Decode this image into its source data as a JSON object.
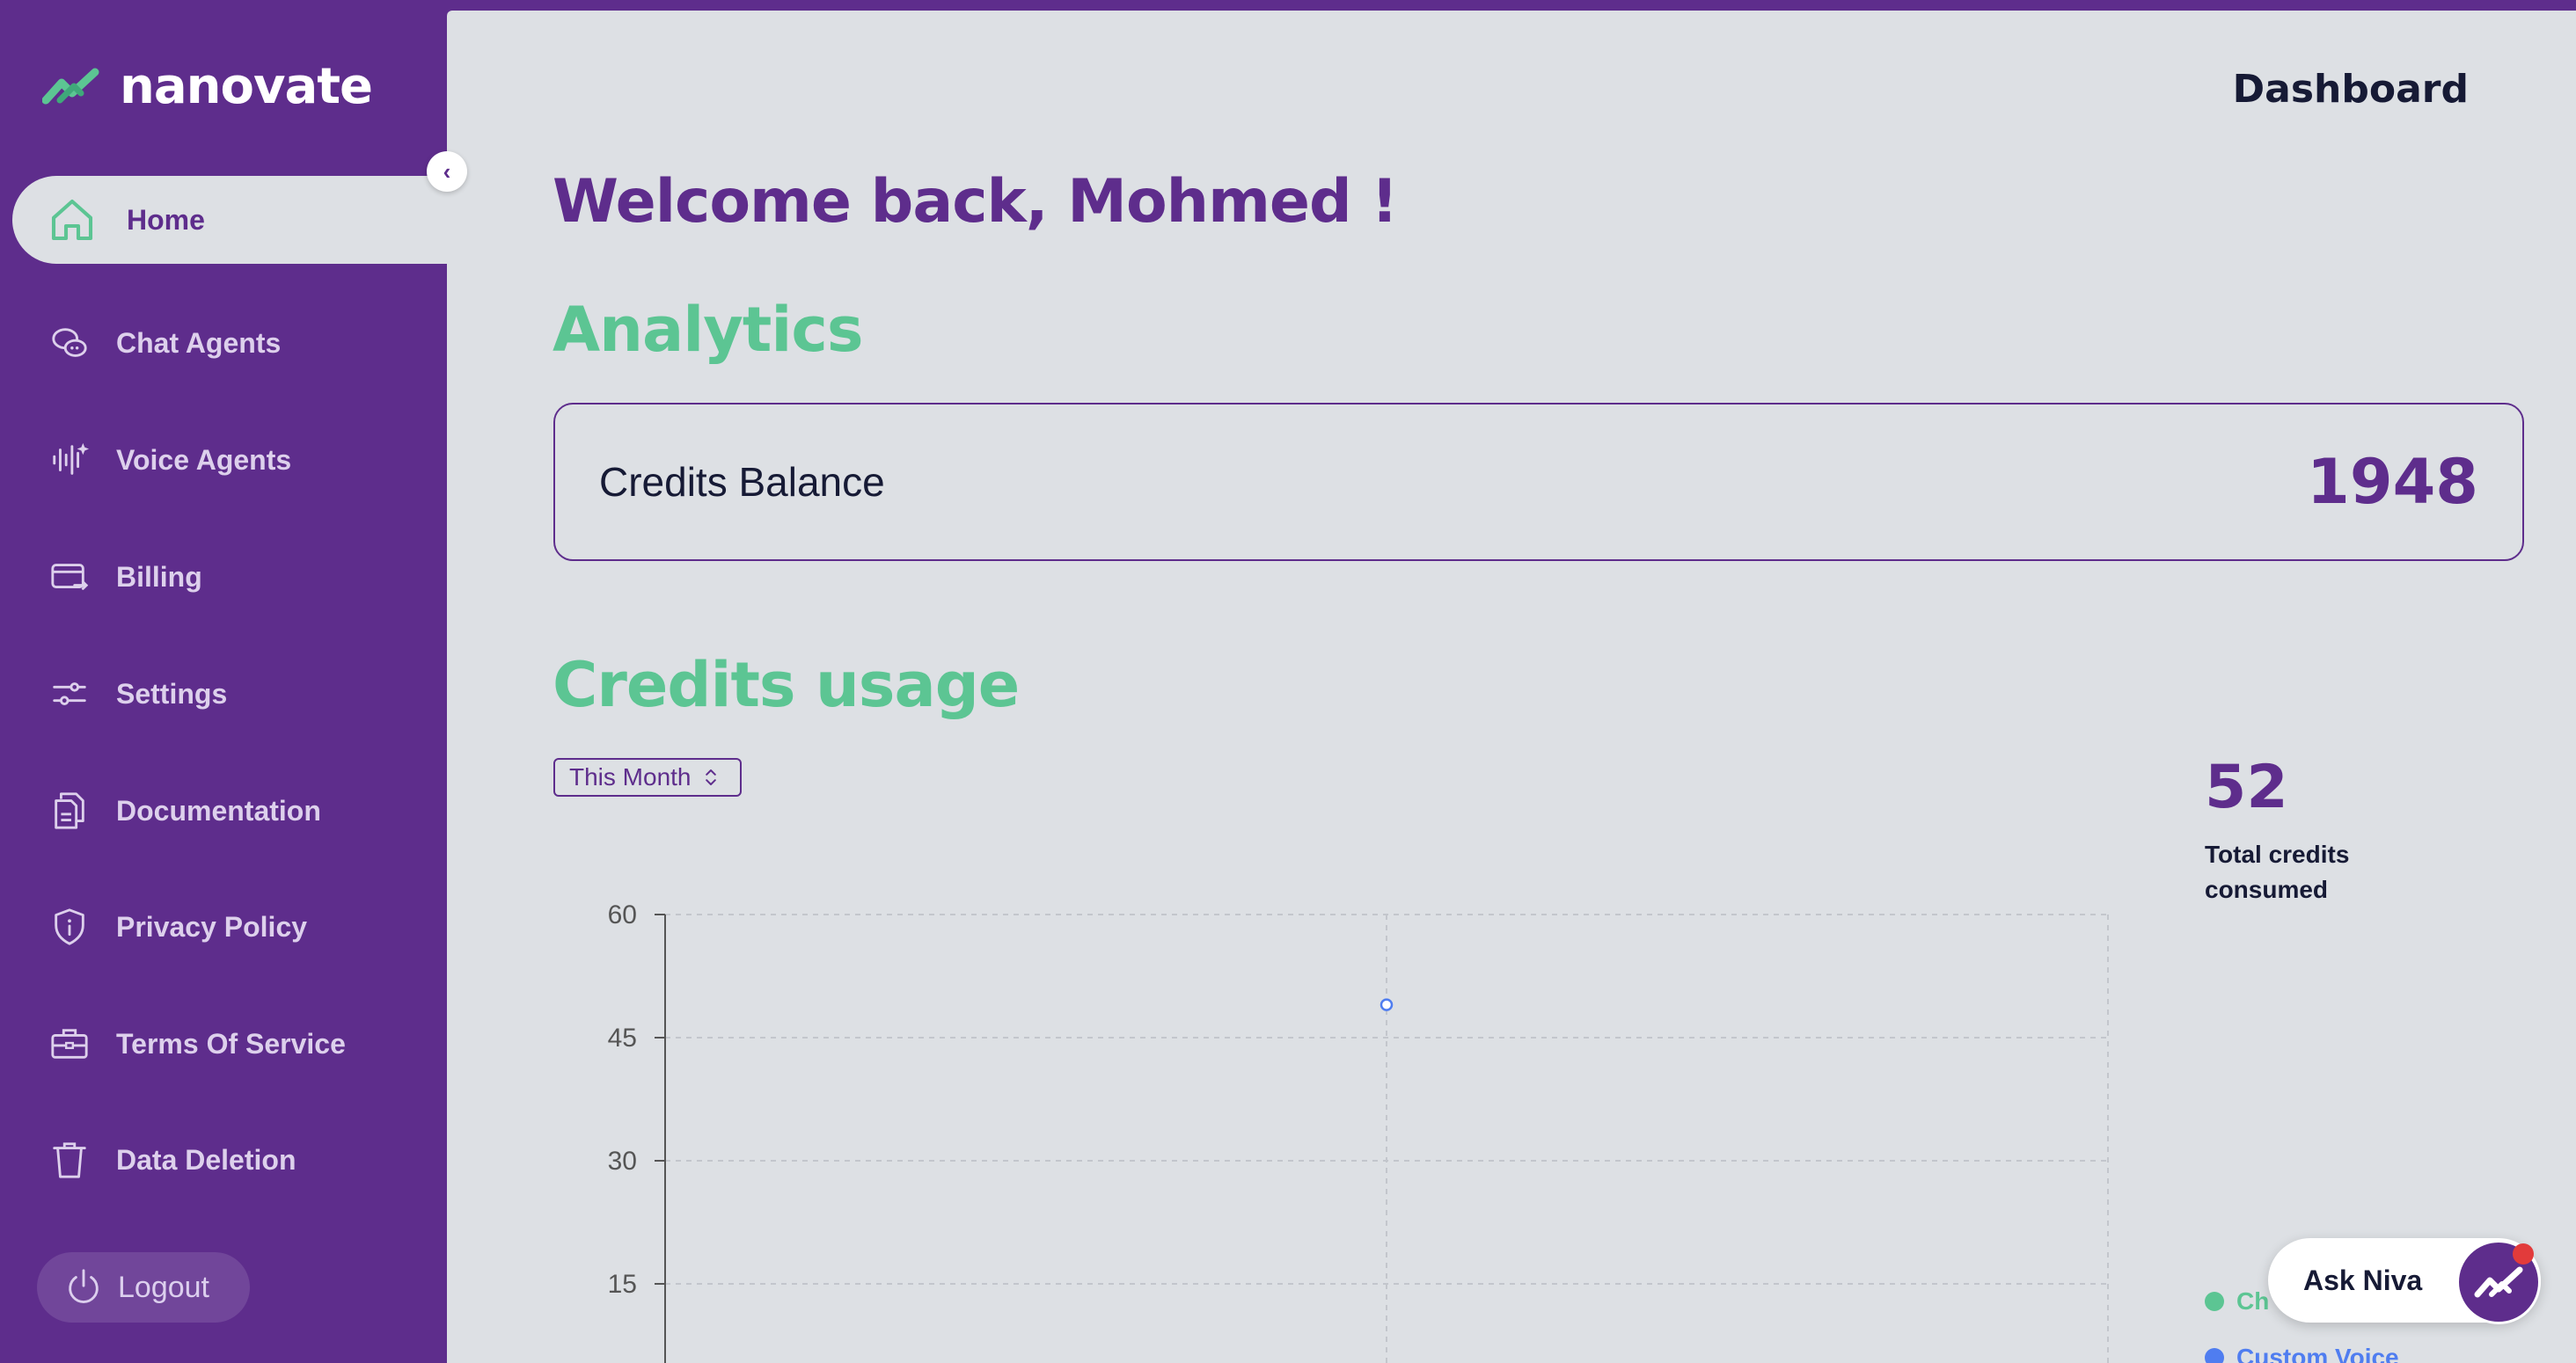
{
  "app": {
    "name": "nanovate"
  },
  "sidebar": {
    "items": [
      {
        "label": "Home",
        "icon": "home-icon",
        "active": true
      },
      {
        "label": "Chat Agents",
        "icon": "chat-icon"
      },
      {
        "label": "Voice Agents",
        "icon": "voice-wave-icon"
      },
      {
        "label": "Billing",
        "icon": "card-icon"
      },
      {
        "label": "Settings",
        "icon": "sliders-icon"
      },
      {
        "label": "Documentation",
        "icon": "documents-icon"
      },
      {
        "label": "Privacy Policy",
        "icon": "shield-icon"
      },
      {
        "label": "Terms Of Service",
        "icon": "briefcase-icon"
      },
      {
        "label": "Data Deletion",
        "icon": "trash-icon"
      }
    ],
    "logout_label": "Logout",
    "collapse_glyph": "‹"
  },
  "header": {
    "title": "Dashboard"
  },
  "welcome": "Welcome back, Mohmed !",
  "analytics": {
    "title": "Analytics",
    "credits_label": "Credits Balance",
    "credits_value": "1948"
  },
  "usage": {
    "title": "Credits usage",
    "period": "This Month",
    "total_value": "52",
    "total_label": "Total credits consumed"
  },
  "chart_data": {
    "type": "line",
    "y_ticks": [
      15,
      30,
      45,
      60
    ],
    "ylim": [
      0,
      60
    ],
    "series": [
      {
        "name": "Ch",
        "color": "#5cc593"
      },
      {
        "name": "Custom Voice",
        "color": "#4f7df0",
        "points": [
          {
            "x": 0.5,
            "y": 49
          }
        ]
      }
    ],
    "grid": true
  },
  "assistant": {
    "label": "Ask Niva"
  },
  "colors": {
    "brand": "#5e2d8c",
    "accent": "#5cc593",
    "background": "#dde0e4"
  }
}
